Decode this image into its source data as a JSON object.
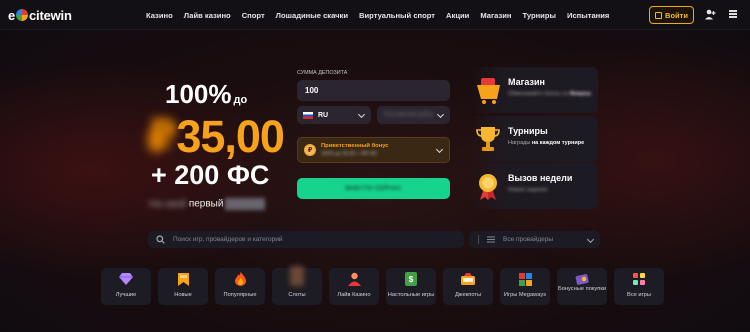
{
  "header": {
    "logo_text": "excitewin",
    "nav": [
      "Казино",
      "Лайв казино",
      "Спорт",
      "Лошадиные скачки",
      "Виртуальный спорт",
      "Акции",
      "Магазин",
      "Турниры",
      "Испытания"
    ],
    "login_label": "Войти"
  },
  "promo": {
    "percent": "100%",
    "percent_suffix": "до",
    "amount": "35,00",
    "free_spins": "+ 200 ФС",
    "first_label": "первый"
  },
  "deposit": {
    "label": "СУММА ДЕПОЗИТА",
    "amount_value": "100",
    "language": "RU",
    "bonus_title": "Приветственный бонус"
  },
  "cards": [
    {
      "title": "Магазин",
      "sub_prefix": "",
      "sub_bold": ""
    },
    {
      "title": "Турниры",
      "sub_prefix": "Награды",
      "sub_bold": "на каждом турнире"
    },
    {
      "title": "Вызов недели",
      "sub_prefix": "",
      "sub_bold": ""
    }
  ],
  "search": {
    "placeholder": "Поиск игр, провайдеров и категорий",
    "providers_label": "Все провайдеры"
  },
  "categories": [
    {
      "label": "Лучшие",
      "icon": "diamond-icon"
    },
    {
      "label": "Новые",
      "icon": "ribbon-icon"
    },
    {
      "label": "Популярные",
      "icon": "flame-icon"
    },
    {
      "label": "Слоты",
      "icon": "slots-thumb"
    },
    {
      "label": "Лайв Казино",
      "icon": "dealer-icon"
    },
    {
      "label": "Настольные игры",
      "icon": "table-games-icon"
    },
    {
      "label": "Джекпоты",
      "icon": "jackpot-icon"
    },
    {
      "label": "Игры Megaways",
      "icon": "megaways-icon"
    },
    {
      "label": "Бонусные покупки",
      "icon": "bonus-buy-icon"
    },
    {
      "label": "Все игры",
      "icon": "all-games-icon"
    }
  ],
  "colors": {
    "accent": "#f7a21b",
    "cta": "#17d48d",
    "panel": "#1c1a22"
  }
}
